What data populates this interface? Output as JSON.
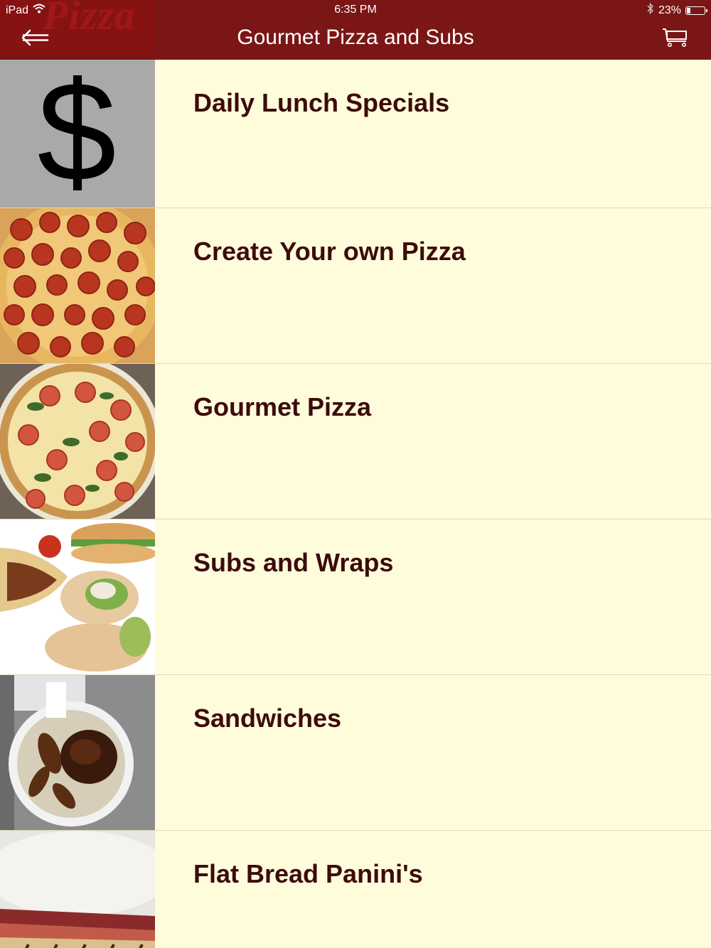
{
  "status_bar": {
    "device": "iPad",
    "time": "6:35 PM",
    "battery": "23%",
    "battery_level": 0.23
  },
  "header": {
    "brand_watermark": "Pizza",
    "title": "Gourmet Pizza and Subs",
    "back_icon": "back-arrow-icon",
    "cart_icon": "cart-icon"
  },
  "colors": {
    "nav_background": "#7a1616",
    "list_background": "#fffcdc",
    "label_text": "#3d0b0b"
  },
  "menu": {
    "items": [
      {
        "label": "Daily Lunch Specials",
        "image": "dollar-sign-image"
      },
      {
        "label": "Create Your own Pizza",
        "image": "pepperoni-pizza-image"
      },
      {
        "label": "Gourmet Pizza",
        "image": "tomato-spinach-pizza-image"
      },
      {
        "label": "Subs and Wraps",
        "image": "subs-wraps-image"
      },
      {
        "label": "Sandwiches",
        "image": "sandwich-plate-image"
      },
      {
        "label": "Flat Bread Panini's",
        "image": "flatbread-panini-image"
      }
    ]
  }
}
